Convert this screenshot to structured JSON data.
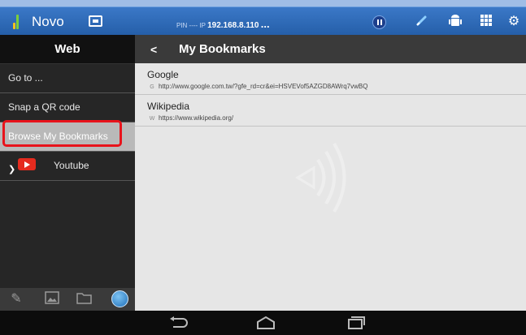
{
  "topbar": {
    "app_name": "Novo",
    "pin_label": "PIN ---- IP",
    "ip": "192.168.8.110",
    "more": "...",
    "icons": [
      "novo-logo-icon",
      "screen-share-icon",
      "pause-icon",
      "link-icon",
      "android-icon",
      "grid-icon",
      "gear-icon"
    ]
  },
  "sidebar": {
    "title": "Web",
    "items": [
      {
        "label": "Go to ..."
      },
      {
        "label": "Snap a QR code"
      },
      {
        "label": "Browse My Bookmarks",
        "selected": true
      },
      {
        "label": "Youtube"
      }
    ],
    "tools": [
      "pencil-icon",
      "image-icon",
      "folder-icon",
      "globe-icon"
    ]
  },
  "main": {
    "back": "<",
    "title": "My Bookmarks",
    "bookmarks": [
      {
        "title": "Google",
        "favicon": "G",
        "url": "http://www.google.com.tw/?gfe_rd=cr&ei=HSVEVof5AZGD8AWrq7vwBQ"
      },
      {
        "title": "Wikipedia",
        "favicon": "W",
        "url": "https://www.wikipedia.org/"
      }
    ]
  },
  "navbar": {
    "icons": [
      "back-icon",
      "home-icon",
      "recents-icon"
    ]
  },
  "colors": {
    "topbar": "#2f6bb8",
    "highlight": "#e8131b",
    "sidebar": "#262626"
  }
}
